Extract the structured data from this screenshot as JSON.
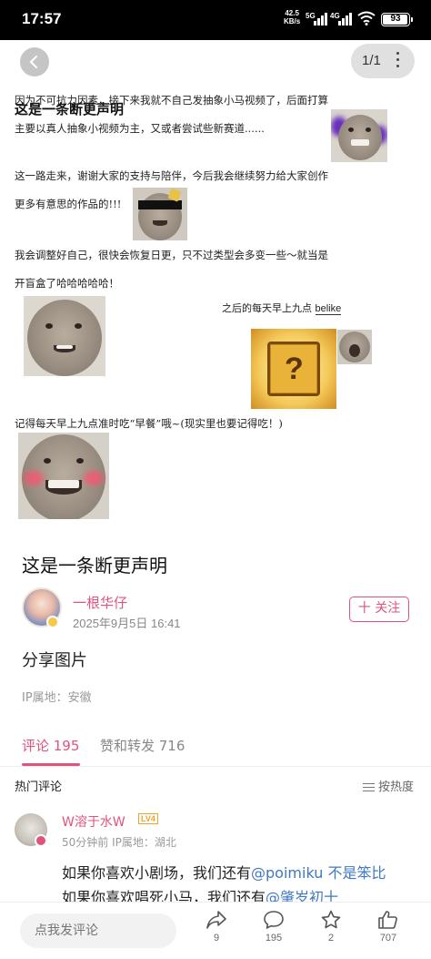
{
  "status_bar": {
    "time": "17:57",
    "net_speed_value": "42.5",
    "net_speed_unit": "KB/s",
    "net_1": "5G",
    "net_2": "4G",
    "battery": "93"
  },
  "image_viewer": {
    "page_counter": "1/1",
    "image_text": {
      "title": "这是一条断更声明",
      "p1_l1": "因为不可抗力因素，接下来我就不自己发抽象小马视频了，后面打算",
      "p1_l2": "主要以真人抽象小视频为主，又或者尝试些新赛道......",
      "p2_l1": "这一路走来，谢谢大家的支持与陪伴，今后我会继续努力给大家创作",
      "p2_l2": "更多有意思的作品的!!!",
      "p3_l1": "我会调整好自己，很快会恢复日更，只不过类型会多变一些～就当是",
      "p3_l2": "开盲盒了哈哈哈哈哈！",
      "caption_prefix": "之后的每天早上九点 ",
      "caption_word": "belike",
      "p4": "记得每天早上九点准时吃“早餐”哦~(现实里也要记得吃！)"
    }
  },
  "post": {
    "title": "这是一条断更声明",
    "author": "一根华仔",
    "date": "2025年9月5日 16:41",
    "follow_label": "十 关注",
    "body": "分享图片",
    "ip": "IP属地：安徽"
  },
  "tabs": [
    {
      "label": "评论 195",
      "active": true
    },
    {
      "label": "赞和转发 716",
      "active": false
    }
  ],
  "comments_header": {
    "title": "热门评论",
    "sort_label": "按热度"
  },
  "comment": {
    "user": "W溶于水W",
    "level": "LV4",
    "meta": "50分钟前 IP属地：湖北",
    "line1_prefix": "如果你喜欢小剧场，我们还有",
    "line1_mention": "@poimiku 不是笨比",
    "line2_prefix": "如果你喜欢唱死小马，我们还有",
    "line2_mention": "@肇岁初十"
  },
  "bottom_bar": {
    "input_placeholder": "点我发评论",
    "share_count": "9",
    "comment_count": "195",
    "favorite_count": "2",
    "like_count": "707"
  },
  "colors": {
    "accent": "#e2527a",
    "mention": "#3f78c4",
    "lootbox": "#e9b33a"
  }
}
